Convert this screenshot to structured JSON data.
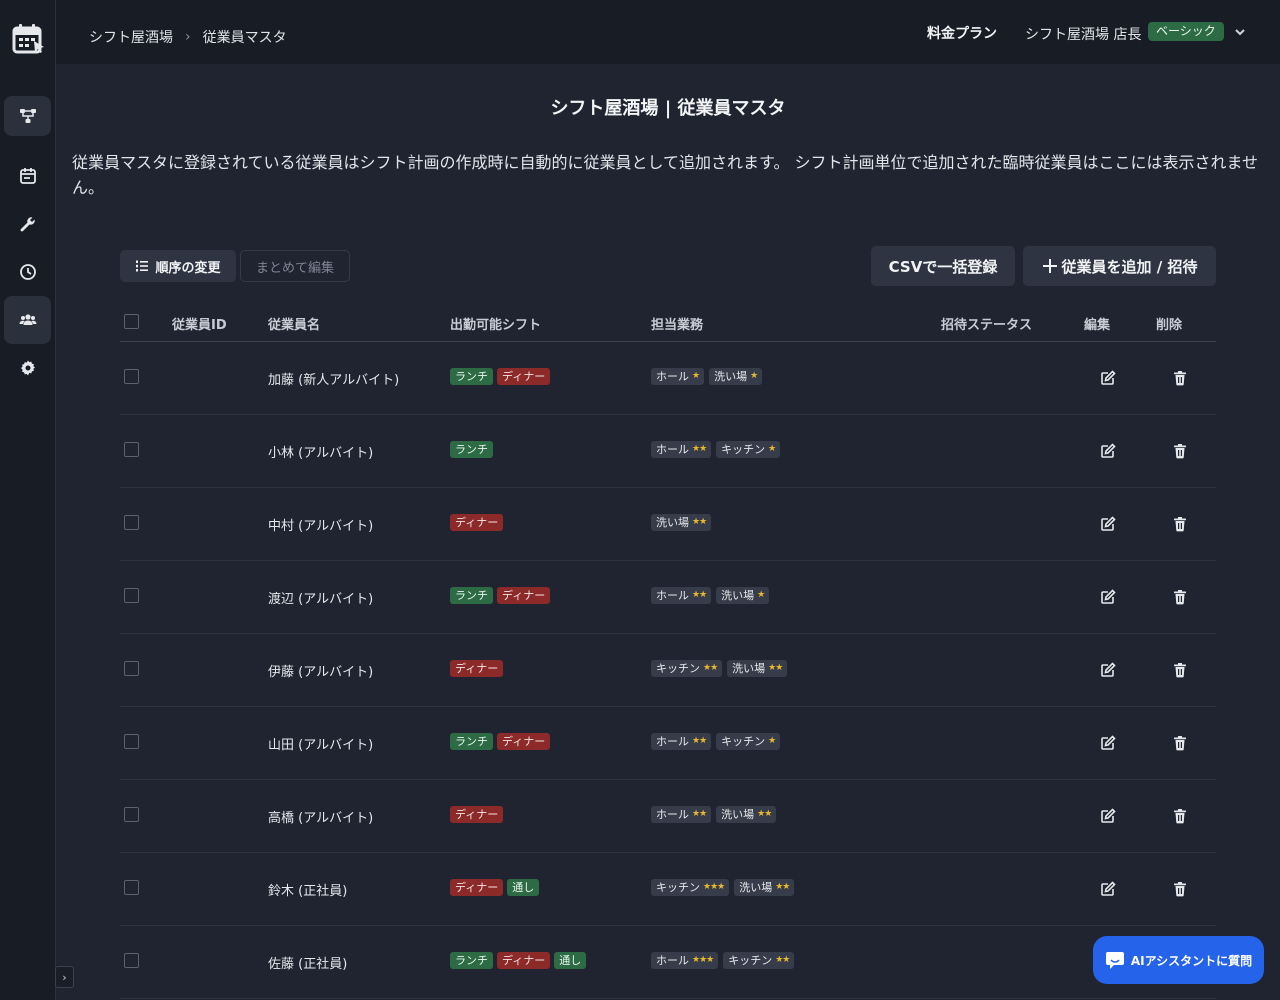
{
  "breadcrumb": [
    "シフト屋酒場",
    "従業員マスタ"
  ],
  "header": {
    "plan_link": "料金プラン",
    "user_name": "シフト屋酒場 店長",
    "plan_badge": "ベーシック"
  },
  "page": {
    "title": "シフト屋酒場 | 従業員マスタ",
    "description": "従業員マスタに登録されている従業員はシフト計画の作成時に自動的に従業員として追加されます。 シフト計画単位で追加された臨時従業員はここには表示されません。"
  },
  "toolbar": {
    "order_label": "順序の変更",
    "bulk_edit_label": "まとめて編集",
    "csv_label": "CSVで一括登録",
    "add_label": "従業員を追加 / 招待"
  },
  "table": {
    "columns": [
      "従業員ID",
      "従業員名",
      "出勤可能シフト",
      "担当業務",
      "招待ステータス",
      "編集",
      "削除"
    ],
    "rows": [
      {
        "name": "加藤 (新人アルバイト)",
        "shifts": [
          {
            "label": "ランチ",
            "kind": "lunch"
          },
          {
            "label": "ディナー",
            "kind": "dinner"
          }
        ],
        "tasks": [
          {
            "label": "ホール",
            "stars": "★"
          },
          {
            "label": "洗い場",
            "stars": "★"
          }
        ]
      },
      {
        "name": "小林 (アルバイト)",
        "shifts": [
          {
            "label": "ランチ",
            "kind": "lunch"
          }
        ],
        "tasks": [
          {
            "label": "ホール",
            "stars": "★★"
          },
          {
            "label": "キッチン",
            "stars": "★"
          }
        ]
      },
      {
        "name": "中村 (アルバイト)",
        "shifts": [
          {
            "label": "ディナー",
            "kind": "dinner"
          }
        ],
        "tasks": [
          {
            "label": "洗い場",
            "stars": "★★"
          }
        ]
      },
      {
        "name": "渡辺 (アルバイト)",
        "shifts": [
          {
            "label": "ランチ",
            "kind": "lunch"
          },
          {
            "label": "ディナー",
            "kind": "dinner"
          }
        ],
        "tasks": [
          {
            "label": "ホール",
            "stars": "★★"
          },
          {
            "label": "洗い場",
            "stars": "★"
          }
        ]
      },
      {
        "name": "伊藤 (アルバイト)",
        "shifts": [
          {
            "label": "ディナー",
            "kind": "dinner"
          }
        ],
        "tasks": [
          {
            "label": "キッチン",
            "stars": "★★"
          },
          {
            "label": "洗い場",
            "stars": "★★"
          }
        ]
      },
      {
        "name": "山田 (アルバイト)",
        "shifts": [
          {
            "label": "ランチ",
            "kind": "lunch"
          },
          {
            "label": "ディナー",
            "kind": "dinner"
          }
        ],
        "tasks": [
          {
            "label": "ホール",
            "stars": "★★"
          },
          {
            "label": "キッチン",
            "stars": "★"
          }
        ]
      },
      {
        "name": "高橋 (アルバイト)",
        "shifts": [
          {
            "label": "ディナー",
            "kind": "dinner"
          }
        ],
        "tasks": [
          {
            "label": "ホール",
            "stars": "★★"
          },
          {
            "label": "洗い場",
            "stars": "★★"
          }
        ]
      },
      {
        "name": "鈴木 (正社員)",
        "shifts": [
          {
            "label": "ディナー",
            "kind": "dinner"
          },
          {
            "label": "通し",
            "kind": "through"
          }
        ],
        "tasks": [
          {
            "label": "キッチン",
            "stars": "★★★"
          },
          {
            "label": "洗い場",
            "stars": "★★"
          }
        ]
      },
      {
        "name": "佐藤 (正社員)",
        "shifts": [
          {
            "label": "ランチ",
            "kind": "lunch"
          },
          {
            "label": "ディナー",
            "kind": "dinner"
          },
          {
            "label": "通し",
            "kind": "through"
          }
        ],
        "tasks": [
          {
            "label": "ホール",
            "stars": "★★★"
          },
          {
            "label": "キッチン",
            "stars": "★★"
          }
        ]
      }
    ]
  },
  "ai_assistant": {
    "label": "AIアシスタントに質問"
  },
  "sidebar": {
    "items": [
      {
        "icon": "flow-icon",
        "active": true
      },
      {
        "icon": "calendar-icon",
        "active": false
      },
      {
        "icon": "wrench-icon",
        "active": false
      },
      {
        "icon": "clock-icon",
        "active": false
      },
      {
        "icon": "users-icon",
        "active": true
      },
      {
        "icon": "gear-icon",
        "active": false
      }
    ]
  },
  "colors": {
    "lunch": "#2d6b45",
    "dinner": "#8c2a2a",
    "accent": "#2563eb",
    "star": "#e8b730"
  }
}
